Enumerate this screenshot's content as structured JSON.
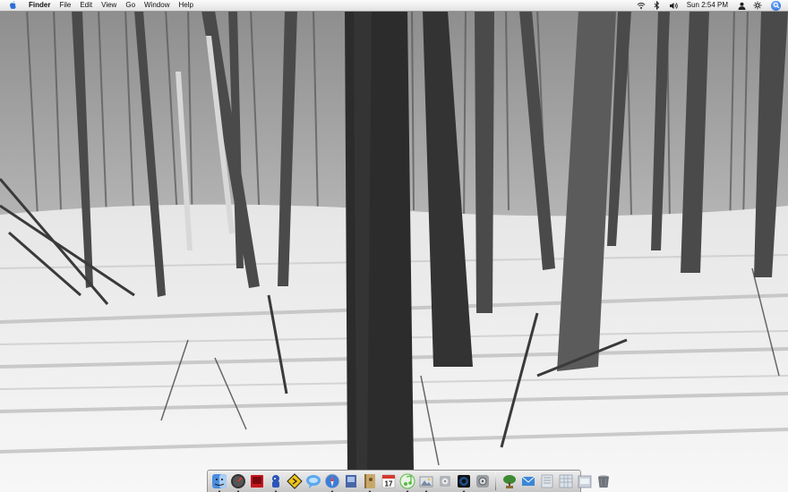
{
  "menubar": {
    "app_name": "Finder",
    "menus": [
      "File",
      "Edit",
      "View",
      "Go",
      "Window",
      "Help"
    ],
    "clock": "Sun 2:54 PM"
  },
  "status_icons": [
    "airport-wifi-icon",
    "bluetooth-icon",
    "volume-icon",
    "user-icon",
    "sync-icon",
    "spotlight-icon"
  ],
  "dock": {
    "items": [
      {
        "name": "finder",
        "color": "#4a8de0",
        "running": true
      },
      {
        "name": "dashboard",
        "color": "#333333",
        "running": true
      },
      {
        "name": "photo-booth",
        "color": "#c4161c",
        "running": false
      },
      {
        "name": "automator",
        "color": "#2a54b8",
        "running": true
      },
      {
        "name": "console",
        "color": "#f0c419",
        "running": false
      },
      {
        "name": "ichat",
        "color": "#5aa7ef",
        "running": false
      },
      {
        "name": "safari",
        "color": "#3d7dd6",
        "running": true
      },
      {
        "name": "preview",
        "color": "#4966a8",
        "running": false
      },
      {
        "name": "address-book",
        "color": "#c8a86a",
        "running": true
      },
      {
        "name": "ical",
        "color": "#d23b2f",
        "running": false
      },
      {
        "name": "itunes",
        "color": "#57b847",
        "running": true
      },
      {
        "name": "iphoto",
        "color": "#7a8aa0",
        "running": true
      },
      {
        "name": "disk-utility",
        "color": "#b0b4b8",
        "running": false
      },
      {
        "name": "quicktime",
        "color": "#1c4f8f",
        "running": true
      },
      {
        "name": "system-preferences",
        "color": "#9a9ea3",
        "running": false
      }
    ],
    "docs": [
      {
        "name": "bonsai-app",
        "color": "#3e8a34"
      },
      {
        "name": "mail",
        "color": "#3b87d6"
      },
      {
        "name": "text-document",
        "color": "#dfe6ec"
      },
      {
        "name": "spreadsheet-document",
        "color": "#d9e3ea"
      },
      {
        "name": "folder-stack",
        "color": "#c9d2dc"
      },
      {
        "name": "trash",
        "color": "#6e737a"
      }
    ]
  }
}
